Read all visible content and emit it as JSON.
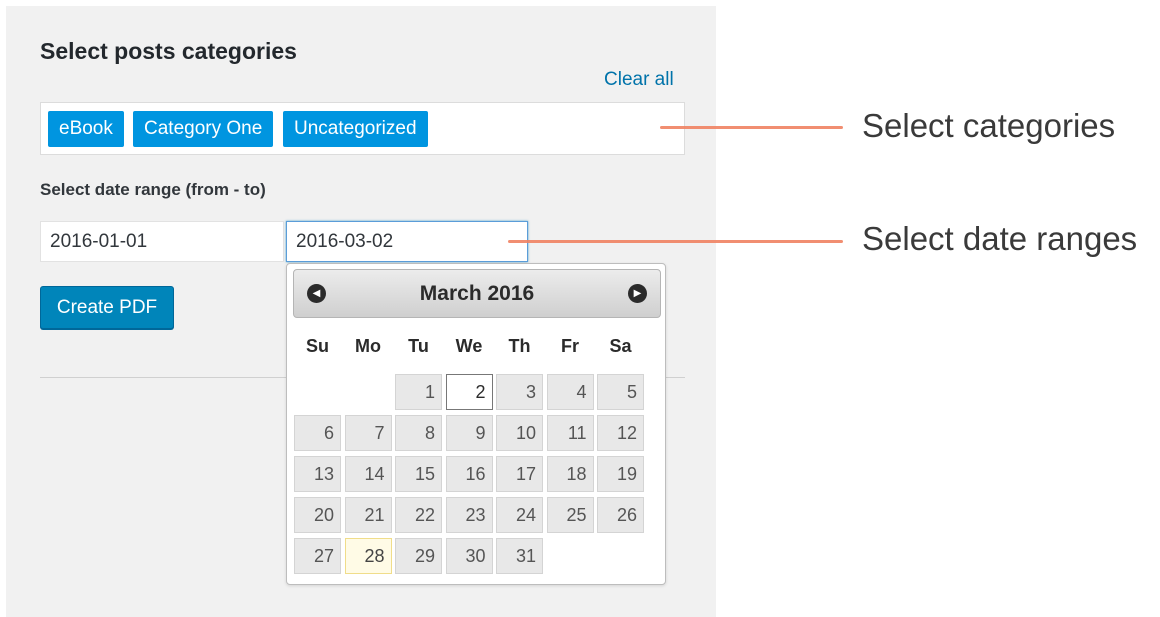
{
  "categories": {
    "title": "Select posts categories",
    "clear_all": "Clear all",
    "tags": [
      "eBook",
      "Category One",
      "Uncategorized"
    ]
  },
  "dates": {
    "label": "Select date range (from - to)",
    "from": "2016-01-01",
    "to": "2016-03-02"
  },
  "create_pdf": "Create PDF",
  "calendar": {
    "title": "March 2016",
    "prev_icon": "circle-arrow-left-icon",
    "next_icon": "circle-arrow-right-icon",
    "weekdays": [
      "Su",
      "Mo",
      "Tu",
      "We",
      "Th",
      "Fr",
      "Sa"
    ],
    "first_weekday_index": 2,
    "days_in_month": 31,
    "selected_day": 2,
    "highlighted_day": 28
  },
  "annotations": {
    "categories": "Select categories",
    "dates": "Select date ranges",
    "line_color": "#f08262"
  },
  "colors": {
    "tag_bg": "#0095e0",
    "button_bg": "#0085ba",
    "link": "#0073aa"
  }
}
